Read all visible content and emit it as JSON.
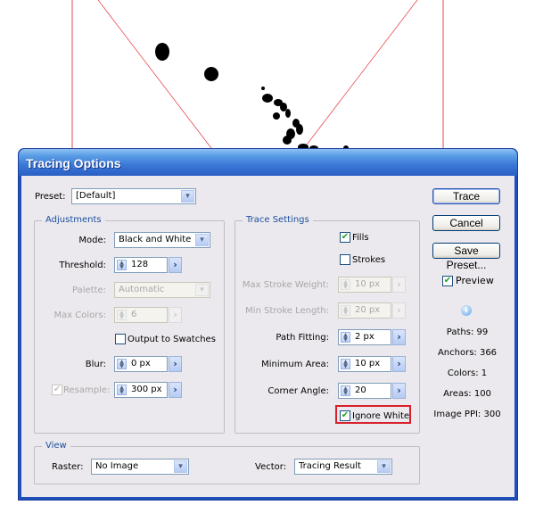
{
  "window": {
    "title": "Tracing Options"
  },
  "preset": {
    "label": "Preset:",
    "value": "[Default]"
  },
  "adjustments": {
    "title": "Adjustments",
    "mode": {
      "label": "Mode:",
      "value": "Black and White"
    },
    "threshold": {
      "label": "Threshold:",
      "value": "128"
    },
    "palette": {
      "label": "Palette:",
      "value": "Automatic"
    },
    "max_colors": {
      "label": "Max Colors:",
      "value": "6"
    },
    "output_to_swatches": {
      "label": "Output to Swatches",
      "checked": false
    },
    "blur": {
      "label": "Blur:",
      "value": "0 px"
    },
    "resample": {
      "label": "Resample:",
      "value": "300 px",
      "checked": true
    }
  },
  "trace_settings": {
    "title": "Trace Settings",
    "fills": {
      "label": "Fills",
      "checked": true
    },
    "strokes": {
      "label": "Strokes",
      "checked": false
    },
    "max_stroke_weight": {
      "label": "Max Stroke Weight:",
      "value": "10 px"
    },
    "min_stroke_length": {
      "label": "Min Stroke Length:",
      "value": "20 px"
    },
    "path_fitting": {
      "label": "Path Fitting:",
      "value": "2 px"
    },
    "minimum_area": {
      "label": "Minimum Area:",
      "value": "10 px"
    },
    "corner_angle": {
      "label": "Corner Angle:",
      "value": "20"
    },
    "ignore_white": {
      "label": "Ignore White",
      "checked": true
    }
  },
  "view": {
    "title": "View",
    "raster": {
      "label": "Raster:",
      "value": "No Image"
    },
    "vector": {
      "label": "Vector:",
      "value": "Tracing Result"
    }
  },
  "buttons": {
    "trace": "Trace",
    "cancel": "Cancel",
    "save_preset": "Save Preset..."
  },
  "preview": {
    "label": "Preview",
    "checked": true
  },
  "stats": {
    "paths": "Paths: 99",
    "anchors": "Anchors: 366",
    "colors": "Colors: 1",
    "areas": "Areas: 100",
    "image_ppi": "Image PPI: 300"
  },
  "glyphs": {
    "check": "✔",
    "arrow_down": "▾",
    "arrow_right": "›",
    "spin": "▲▼",
    "info": "i"
  },
  "colors": {
    "title_bar": "#3a78d6",
    "highlight": "#d9202a",
    "group_title": "#1d4fa0"
  }
}
